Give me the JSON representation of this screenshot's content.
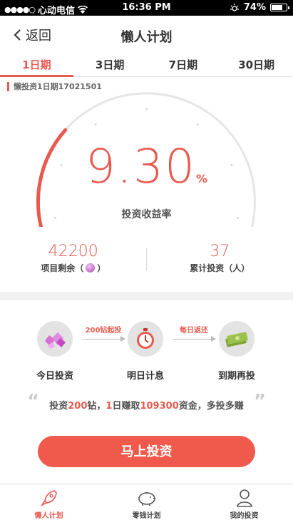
{
  "status_bar": {
    "carrier": "心动电信",
    "time": "16:36 PM",
    "battery": "74%",
    "battery_level": 0.74
  },
  "nav": {
    "back_label": "返回",
    "title": "懒人计划"
  },
  "tabs": [
    {
      "label": "1日期",
      "active": true
    },
    {
      "label": "3日期",
      "active": false
    },
    {
      "label": "7日期",
      "active": false
    },
    {
      "label": "30日期",
      "active": false
    }
  ],
  "product_code": "懒投资1日期17021501",
  "rate": {
    "value": "9.30",
    "unit": "%",
    "label": "投资收益率",
    "gauge_progress": 0.28
  },
  "stats": {
    "remaining_value": "42200",
    "remaining_label_pre": "项目剩余（",
    "remaining_label_post": "）",
    "total_value": "37",
    "total_label": "累计投资（人）"
  },
  "steps": [
    {
      "label": "今日投资",
      "icon": "gems-icon"
    },
    {
      "label": "明日计息",
      "icon": "stopwatch-icon"
    },
    {
      "label": "到期再投",
      "icon": "money-icon"
    }
  ],
  "arrows": [
    {
      "label": "200钻起投"
    },
    {
      "label": "每日返还"
    }
  ],
  "promo": {
    "p1": "投资",
    "h1": "200",
    "p2": "钻，",
    "h2": "1",
    "p3": "日赚取",
    "h3": "109300",
    "p4": "资金，多投多赚"
  },
  "invest_button": "马上投资",
  "tabbar": [
    {
      "label": "懒人计划",
      "icon": "rocket-icon",
      "active": true
    },
    {
      "label": "零钱计划",
      "icon": "piggy-bank-icon",
      "active": false
    },
    {
      "label": "我的投资",
      "icon": "user-icon",
      "active": false
    }
  ],
  "colors": {
    "accent": "#e85a4f",
    "gauge_track": "#e6e6e6"
  }
}
